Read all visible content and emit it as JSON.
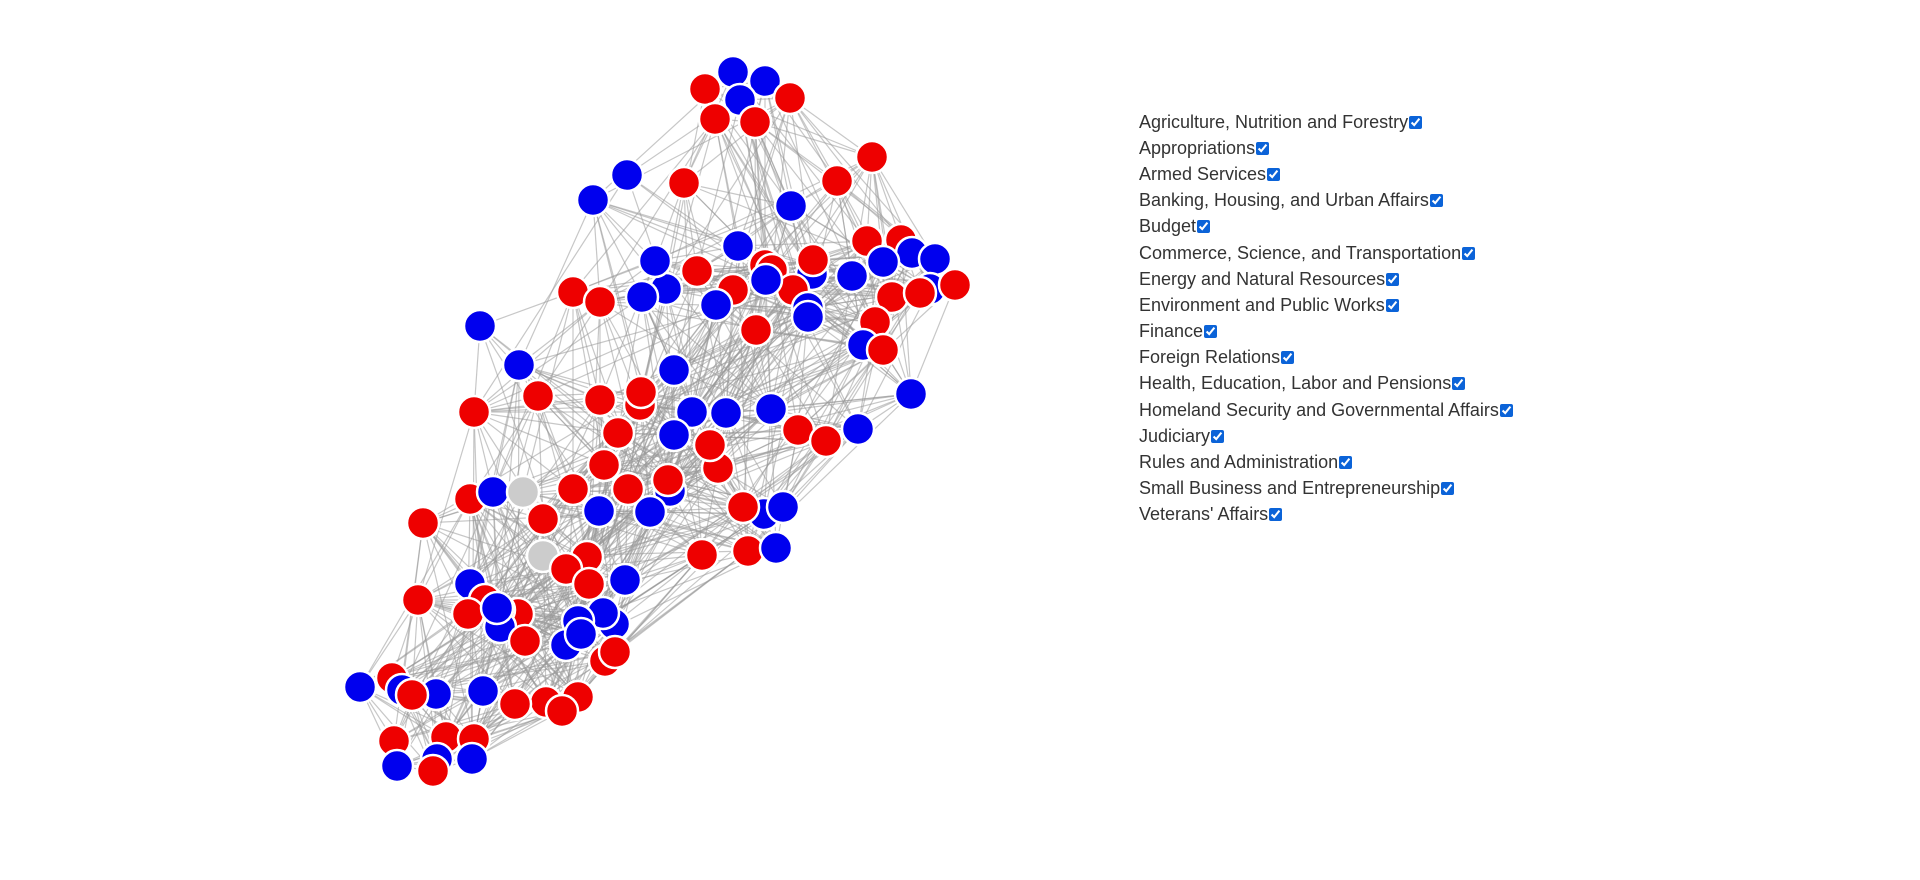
{
  "legend": {
    "committees": [
      {
        "label": "Agriculture, Nutrition and Forestry",
        "checked": true
      },
      {
        "label": "Appropriations",
        "checked": true
      },
      {
        "label": "Armed Services",
        "checked": true
      },
      {
        "label": "Banking, Housing, and Urban Affairs",
        "checked": true
      },
      {
        "label": "Budget",
        "checked": true
      },
      {
        "label": "Commerce, Science, and Transportation",
        "checked": true
      },
      {
        "label": "Energy and Natural Resources",
        "checked": true
      },
      {
        "label": "Environment and Public Works",
        "checked": true
      },
      {
        "label": "Finance",
        "checked": true
      },
      {
        "label": "Foreign Relations",
        "checked": true
      },
      {
        "label": "Health, Education, Labor and Pensions",
        "checked": true
      },
      {
        "label": "Homeland Security and Governmental Affairs",
        "checked": true
      },
      {
        "label": "Judiciary",
        "checked": true
      },
      {
        "label": "Rules and Administration",
        "checked": true
      },
      {
        "label": "Small Business and Entrepreneurship",
        "checked": true
      },
      {
        "label": "Veterans' Affairs",
        "checked": true
      }
    ]
  },
  "colors": {
    "democrat": "#0000ee",
    "republican": "#ee0000",
    "independent": "#cccccc",
    "edge": "#999999",
    "checkbox_accent": "#0b63d8",
    "text": "#333333"
  },
  "party_sequence": "DRDDRRRRDDRRDDRRDDDRRDDRRDRDDRDRDDRDRRDRRDRDRDDRRDRRRDDRDDRDRDRRDRRDDRRIRRRDDIRRRDDRRRDRDDRRDDRRRRRDDDRDRRDRRDDRRRDDRRDR"
}
